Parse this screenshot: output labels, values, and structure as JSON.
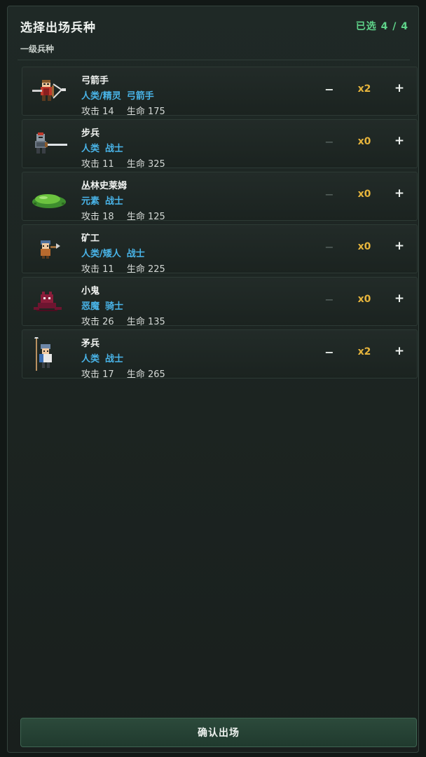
{
  "header": {
    "title": "选择出场兵种",
    "selected_label": "已选",
    "selected_count": "4 / 4",
    "section": "一级兵种"
  },
  "units": [
    {
      "name": "弓箭手",
      "tags": [
        "人类/精灵",
        "弓箭手"
      ],
      "atk_label": "攻击",
      "atk": "14",
      "hp_label": "生命",
      "hp": "175",
      "count": "x2",
      "minus": "−",
      "plus": "+",
      "sprite": "archer-sprite",
      "minus_enabled": true
    },
    {
      "name": "步兵",
      "tags": [
        "人类",
        "战士"
      ],
      "atk_label": "攻击",
      "atk": "11",
      "hp_label": "生命",
      "hp": "325",
      "count": "x0",
      "minus": "−",
      "plus": "+",
      "sprite": "footman-sprite",
      "minus_enabled": false
    },
    {
      "name": "丛林史莱姆",
      "tags": [
        "元素",
        "战士"
      ],
      "atk_label": "攻击",
      "atk": "18",
      "hp_label": "生命",
      "hp": "125",
      "count": "x0",
      "minus": "−",
      "plus": "+",
      "sprite": "jungle-slime-sprite",
      "minus_enabled": false
    },
    {
      "name": "矿工",
      "tags": [
        "人类/矮人",
        "战士"
      ],
      "atk_label": "攻击",
      "atk": "11",
      "hp_label": "生命",
      "hp": "225",
      "count": "x0",
      "minus": "−",
      "plus": "+",
      "sprite": "miner-sprite",
      "minus_enabled": false
    },
    {
      "name": "小鬼",
      "tags": [
        "恶魔",
        "骑士"
      ],
      "atk_label": "攻击",
      "atk": "26",
      "hp_label": "生命",
      "hp": "135",
      "count": "x0",
      "minus": "−",
      "plus": "+",
      "sprite": "imp-sprite",
      "minus_enabled": false
    },
    {
      "name": "矛兵",
      "tags": [
        "人类",
        "战士"
      ],
      "atk_label": "攻击",
      "atk": "17",
      "hp_label": "生命",
      "hp": "265",
      "count": "x2",
      "minus": "−",
      "plus": "+",
      "sprite": "spearman-sprite",
      "minus_enabled": true
    }
  ],
  "confirm_label": "确认出场",
  "colors": {
    "accent_green": "#5fd48a",
    "tag_blue": "#49b4e8",
    "count_gold": "#e6b43c",
    "panel_bg": "#1f2926"
  }
}
